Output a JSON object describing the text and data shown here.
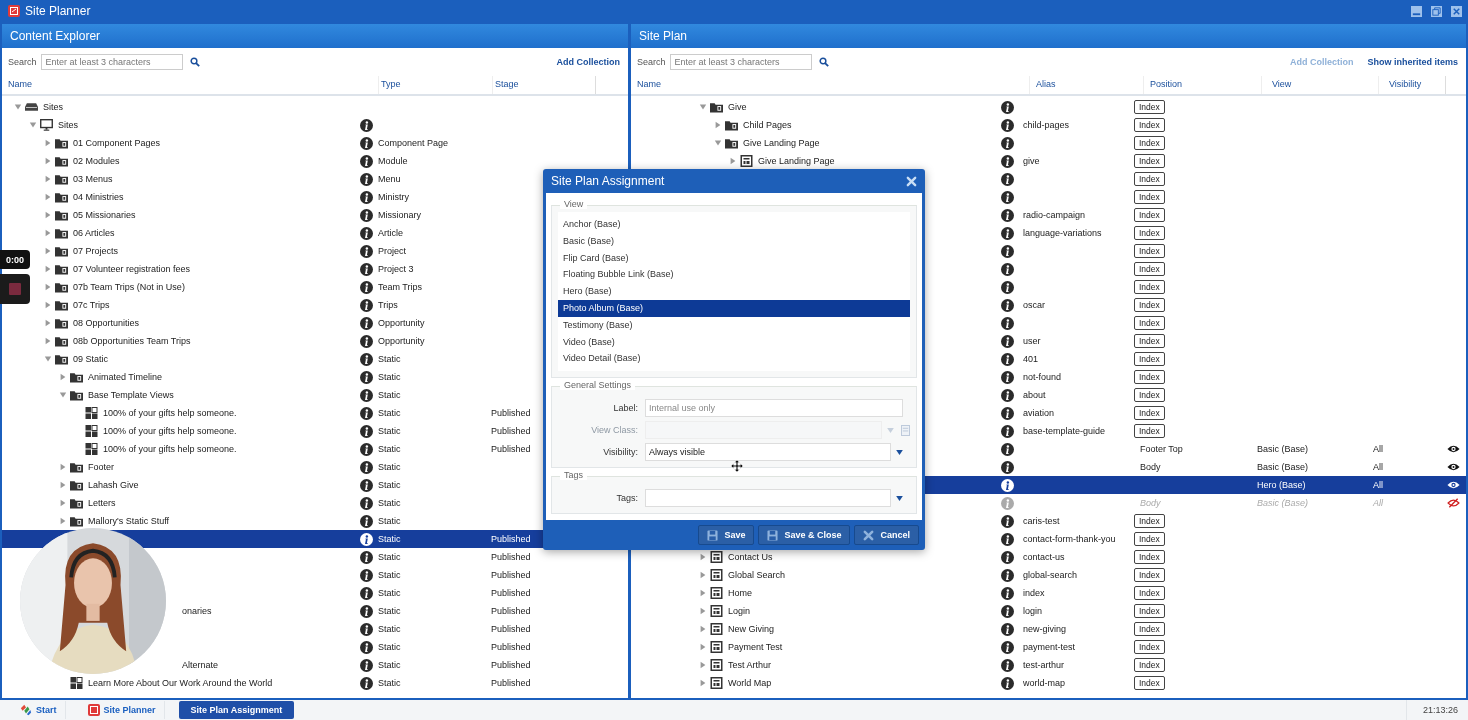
{
  "window": {
    "title": "Site Planner"
  },
  "recorder": {
    "time": "0:00"
  },
  "content_explorer": {
    "title": "Content Explorer",
    "search": {
      "label": "Search",
      "placeholder": "Enter at least 3 characters"
    },
    "add_collection": {
      "label": "Add Collection",
      "disabled": false
    },
    "columns": [
      "Name",
      "Type",
      "Stage"
    ],
    "tree": [
      {
        "name": "Sites",
        "kind": "drive",
        "expanded": true,
        "selected": false,
        "children": [
          {
            "name": "Sites",
            "kind": "monitor",
            "expanded": true,
            "selected": false,
            "children": [
              {
                "name": "01 Component Pages",
                "kind": "folder",
                "expanded": false,
                "type": "Component Page",
                "selected": false
              },
              {
                "name": "02 Modules",
                "kind": "folder",
                "expanded": false,
                "type": "Module",
                "selected": false
              },
              {
                "name": "03 Menus",
                "kind": "folder",
                "expanded": false,
                "type": "Menu",
                "selected": false
              },
              {
                "name": "04 Ministries",
                "kind": "folder",
                "expanded": false,
                "type": "Ministry",
                "selected": false
              },
              {
                "name": "05 Missionaries",
                "kind": "folder",
                "expanded": false,
                "type": "Missionary",
                "selected": false
              },
              {
                "name": "06 Articles",
                "kind": "folder",
                "expanded": false,
                "type": "Article",
                "selected": false
              },
              {
                "name": "07 Projects",
                "kind": "folder",
                "expanded": false,
                "type": "Project",
                "selected": false
              },
              {
                "name": "07 Volunteer registration fees",
                "kind": "folder",
                "expanded": false,
                "type": "Project 3",
                "selected": false
              },
              {
                "name": "07b Team Trips (Not in Use)",
                "kind": "folder",
                "expanded": false,
                "type": "Team Trips",
                "selected": false
              },
              {
                "name": "07c Trips",
                "kind": "folder",
                "expanded": false,
                "type": "Trips",
                "selected": false
              },
              {
                "name": "08 Opportunities",
                "kind": "folder",
                "expanded": false,
                "type": "Opportunity",
                "selected": false
              },
              {
                "name": "08b Opportunities Team Trips",
                "kind": "folder",
                "expanded": false,
                "type": "Opportunity",
                "selected": false
              },
              {
                "name": "09 Static",
                "kind": "folder",
                "expanded": true,
                "type": "Static",
                "selected": false,
                "children": [
                  {
                    "name": "Animated Timeline",
                    "kind": "folder",
                    "expanded": false,
                    "type": "Static",
                    "selected": false
                  },
                  {
                    "name": "Base Template Views",
                    "kind": "folder",
                    "expanded": true,
                    "type": "Static",
                    "selected": false,
                    "children": [
                      {
                        "name": "100% of your gifts help someone.",
                        "kind": "view",
                        "type": "Static",
                        "stage": "Published",
                        "selected": false
                      },
                      {
                        "name": "100% of your gifts help someone.",
                        "kind": "view",
                        "type": "Static",
                        "stage": "Published",
                        "selected": false
                      },
                      {
                        "name": "100% of your gifts help someone.",
                        "kind": "view",
                        "type": "Static",
                        "stage": "Published",
                        "selected": false
                      }
                    ]
                  },
                  {
                    "name": "Footer",
                    "kind": "folder",
                    "expanded": false,
                    "type": "Static",
                    "selected": false
                  },
                  {
                    "name": "Lahash Give",
                    "kind": "folder",
                    "expanded": false,
                    "type": "Static",
                    "selected": false
                  },
                  {
                    "name": "Letters",
                    "kind": "folder",
                    "expanded": false,
                    "type": "Static",
                    "selected": false
                  },
                  {
                    "name": "Mallory's Static Stuff",
                    "kind": "folder",
                    "expanded": false,
                    "type": "Static",
                    "selected": false
                  },
                  {
                    "type": "Static",
                    "stage": "Published",
                    "selected": true
                  },
                  {
                    "type": "Static",
                    "stage": "Published",
                    "selected": false
                  },
                  {
                    "type": "Static",
                    "stage": "Published",
                    "selected": false
                  },
                  {
                    "type": "Static",
                    "stage": "Published",
                    "selected": false
                  },
                  {
                    "name": "onaries",
                    "occluded": true,
                    "type": "Static",
                    "stage": "Published",
                    "selected": false
                  },
                  {
                    "type": "Static",
                    "stage": "Published",
                    "selected": false
                  },
                  {
                    "type": "Static",
                    "stage": "Published",
                    "selected": false
                  },
                  {
                    "name": "Alternate",
                    "occluded": true,
                    "type": "Static",
                    "stage": "Published",
                    "selected": false
                  },
                  {
                    "name": "Learn More About Our Work Around the World",
                    "kind": "view",
                    "type": "Static",
                    "stage": "Published",
                    "selected": false
                  }
                ]
              }
            ]
          }
        ]
      }
    ]
  },
  "site_plan": {
    "title": "Site Plan",
    "search": {
      "label": "Search",
      "placeholder": "Enter at least 3 characters"
    },
    "add_collection": {
      "label": "Add Collection",
      "disabled": true
    },
    "show_inherited": "Show inherited items",
    "columns": [
      "Name",
      "Alias",
      "Position",
      "View",
      "Visibility"
    ],
    "rows": [
      {
        "kind": "folder",
        "name": "Give",
        "expanded": true,
        "position": "Index",
        "selected": false,
        "children": [
          {
            "kind": "folder",
            "name": "Child Pages",
            "expanded": false,
            "alias": "child-pages",
            "position": "Index",
            "selected": false
          },
          {
            "kind": "folder",
            "name": "Give Landing Page",
            "expanded": true,
            "position": "Index",
            "selected": false,
            "children": [
              {
                "kind": "page",
                "name": "Give Landing Page",
                "expanded": false,
                "alias": "give",
                "position": "Index",
                "selected": false
              }
            ]
          }
        ]
      },
      {
        "kind": "page",
        "position": "Index",
        "selected": false
      },
      {
        "kind": "page",
        "position": "Index",
        "selected": false
      },
      {
        "kind": "page",
        "alias": "radio-campaign",
        "position": "Index",
        "selected": false
      },
      {
        "kind": "page",
        "alias": "language-variations",
        "position": "Index",
        "selected": false
      },
      {
        "kind": "page",
        "position": "Index",
        "selected": false
      },
      {
        "kind": "page",
        "position": "Index",
        "selected": false
      },
      {
        "kind": "page",
        "position": "Index",
        "selected": false
      },
      {
        "kind": "page",
        "alias": "oscar",
        "position": "Index",
        "selected": false
      },
      {
        "kind": "page",
        "position": "Index",
        "selected": false
      },
      {
        "kind": "page",
        "alias": "user",
        "position": "Index",
        "selected": false
      },
      {
        "kind": "page",
        "alias": "401",
        "position": "Index",
        "selected": false
      },
      {
        "kind": "page",
        "alias": "not-found",
        "position": "Index",
        "selected": false
      },
      {
        "kind": "page",
        "alias": "about",
        "position": "Index",
        "selected": false
      },
      {
        "kind": "page",
        "alias": "aviation",
        "position": "Index",
        "selected": false
      },
      {
        "kind": "page",
        "alias": "base-template-guide",
        "position": "Index",
        "selected": false
      },
      {
        "kind": "view",
        "position": "Footer Top",
        "view": "Basic (Base)",
        "visibility": "All",
        "visible": true,
        "inherited": false,
        "selected": false
      },
      {
        "kind": "view",
        "position": "Body",
        "view": "Basic (Base)",
        "visibility": "All",
        "visible": true,
        "inherited": false,
        "selected": false
      },
      {
        "kind": "view",
        "view": "Hero (Base)",
        "visibility": "All",
        "visible": true,
        "inherited": false,
        "selected": true
      },
      {
        "kind": "view",
        "position": "Body",
        "view": "Basic (Base)",
        "visibility": "All",
        "visible": false,
        "inherited": true,
        "selected": false
      },
      {
        "kind": "page",
        "alias": "caris-test",
        "position": "Index",
        "selected": false
      },
      {
        "kind": "page",
        "alias": "contact-form-thank-you",
        "position": "Index",
        "selected": false
      },
      {
        "kind": "page",
        "name": "Contact Us",
        "expanded": false,
        "alias": "contact-us",
        "position": "Index",
        "selected": false
      },
      {
        "kind": "page",
        "name": "Global Search",
        "expanded": false,
        "alias": "global-search",
        "position": "Index",
        "selected": false
      },
      {
        "kind": "page",
        "name": "Home",
        "expanded": false,
        "alias": "index",
        "position": "Index",
        "selected": false
      },
      {
        "kind": "page",
        "name": "Login",
        "expanded": false,
        "alias": "login",
        "position": "Index",
        "selected": false
      },
      {
        "kind": "page",
        "name": "New Giving",
        "expanded": false,
        "alias": "new-giving",
        "position": "Index",
        "selected": false
      },
      {
        "kind": "page",
        "name": "Payment Test",
        "expanded": false,
        "alias": "payment-test",
        "position": "Index",
        "selected": false
      },
      {
        "kind": "page",
        "name": "Test Arthur",
        "expanded": false,
        "alias": "test-arthur",
        "position": "Index",
        "selected": false
      },
      {
        "kind": "page",
        "name": "World Map",
        "expanded": false,
        "alias": "world-map",
        "position": "Index",
        "selected": false
      }
    ]
  },
  "dialog": {
    "title": "Site Plan Assignment",
    "view_section": {
      "legend": "View",
      "options": [
        {
          "label": "Anchor (Base)",
          "selected": false
        },
        {
          "label": "Basic (Base)",
          "selected": false
        },
        {
          "label": "Flip Card (Base)",
          "selected": false
        },
        {
          "label": "Floating Bubble Link (Base)",
          "selected": false
        },
        {
          "label": "Hero (Base)",
          "selected": false
        },
        {
          "label": "Photo Album (Base)",
          "selected": true
        },
        {
          "label": "Testimony (Base)",
          "selected": false
        },
        {
          "label": "Video (Base)",
          "selected": false
        },
        {
          "label": "Video Detail (Base)",
          "selected": false
        }
      ]
    },
    "general_section": {
      "legend": "General Settings",
      "fields": [
        {
          "kind": "text",
          "label": "Label:",
          "placeholder": "Internal use only",
          "disabled": false
        },
        {
          "kind": "lookup",
          "label": "View Class:",
          "disabled": true
        },
        {
          "kind": "select",
          "label": "Visibility:",
          "value": "Always visible",
          "disabled": false
        }
      ]
    },
    "tags_section": {
      "legend": "Tags",
      "fields": [
        {
          "kind": "select",
          "label": "Tags:",
          "disabled": false
        }
      ]
    },
    "buttons": [
      {
        "kind": "save",
        "label": "Save"
      },
      {
        "kind": "save",
        "label": "Save & Close"
      },
      {
        "kind": "cancel",
        "label": "Cancel"
      }
    ]
  },
  "taskbar": {
    "items": [
      {
        "kind": "start",
        "label": "Start",
        "selected": false
      },
      {
        "kind": "app",
        "label": "Site Planner",
        "selected": false
      },
      {
        "kind": "app",
        "label": "Site Plan Assignment",
        "selected": true
      }
    ],
    "clock": "21:13:26"
  }
}
